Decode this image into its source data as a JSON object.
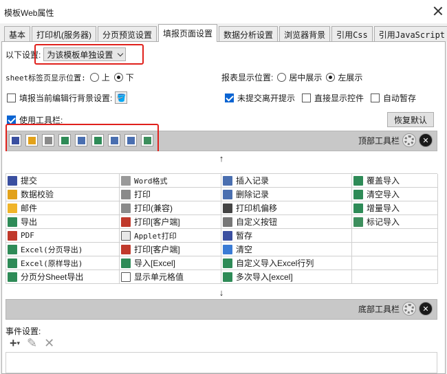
{
  "window": {
    "title": "模板Web属性"
  },
  "tabs": [
    {
      "label": "基本"
    },
    {
      "label": "打印机(服务器)"
    },
    {
      "label": "分页预览设置"
    },
    {
      "label": "填报页面设置"
    },
    {
      "label": "数据分析设置"
    },
    {
      "label": "浏览器背景"
    },
    {
      "label": "引用Css"
    },
    {
      "label": "引用JavaScript"
    }
  ],
  "settings": {
    "scope_label": "以下设置:",
    "scope_value": "为该模板单独设置",
    "sheet_label": "sheet标签页显示位置:",
    "sheet_options": [
      "上",
      "下"
    ],
    "sheet_selected": "下",
    "report_label": "报表显示位置:",
    "report_options": [
      "居中展示",
      "左展示"
    ],
    "report_selected": "左展示",
    "bg_label": "填报当前编辑行背景设置:",
    "unsubmitted_label": "未提交离开提示",
    "direct_label": "直接显示控件",
    "autosave_label": "自动暂存",
    "use_toolbar_label": "使用工具栏:",
    "restore_default": "恢复默认"
  },
  "toolbars": {
    "top_label": "顶部工具栏",
    "bottom_label": "底部工具栏",
    "top_icons": [
      "save-icon",
      "edit-icon",
      "print-icon",
      "export-icon",
      "insert-row-icon",
      "excel-icon",
      "delete-row-icon",
      "insert-row-icon",
      "mark-import-icon"
    ],
    "up_arrow": "↑",
    "down_arrow": "↓"
  },
  "buttons": [
    [
      {
        "label": "提交",
        "icon": "submit-icon",
        "color": "#3a4fa0"
      },
      {
        "label": "Word格式",
        "icon": "word-icon",
        "color": "#9a9a9a",
        "mono": true
      },
      {
        "label": "插入记录",
        "icon": "insert-row-icon",
        "color": "#4a6fb0"
      },
      {
        "label": "覆盖导入",
        "icon": "excel-icon",
        "color": "#2e8b57"
      }
    ],
    [
      {
        "label": "数据校验",
        "icon": "check-icon",
        "color": "#e2a21b"
      },
      {
        "label": "打印",
        "icon": "print-icon",
        "color": "#8a8a8a"
      },
      {
        "label": "删除记录",
        "icon": "delete-row-icon",
        "color": "#4a6fb0"
      },
      {
        "label": "清空导入",
        "icon": "excel-icon",
        "color": "#2e8b57"
      }
    ],
    [
      {
        "label": "邮件",
        "icon": "mail-icon",
        "color": "#f0b429"
      },
      {
        "label": "打印(兼容)",
        "icon": "print-icon",
        "color": "#8a8a8a"
      },
      {
        "label": "打印机偏移",
        "icon": "move-icon",
        "color": "#444444"
      },
      {
        "label": "增量导入",
        "icon": "excel-icon",
        "color": "#2e8b57"
      }
    ],
    [
      {
        "label": "导出",
        "icon": "export-icon",
        "color": "#2e8b57"
      },
      {
        "label": "打印[客户端]",
        "icon": "pdf-print-icon",
        "color": "#c0392b"
      },
      {
        "label": "自定义按钮",
        "icon": "gear-icon",
        "color": "#777777"
      },
      {
        "label": "标记导入",
        "icon": "mark-import-icon",
        "color": "#3d8f5d"
      }
    ],
    [
      {
        "label": "PDF",
        "icon": "pdf-icon",
        "color": "#c0392b",
        "mono": true
      },
      {
        "label": "Applet打印",
        "icon": "applet-icon",
        "color": "#e8e8e8",
        "mono": true
      },
      {
        "label": "暂存",
        "icon": "save-icon",
        "color": "#3a4fa0"
      },
      {
        "label": "",
        "icon": "",
        "color": ""
      }
    ],
    [
      {
        "label": "Excel(分页导出)",
        "icon": "excel-icon",
        "color": "#2e8b57",
        "mono": true
      },
      {
        "label": "打印[客户端]",
        "icon": "pdf-print-icon",
        "color": "#c0392b"
      },
      {
        "label": "清空",
        "icon": "eraser-icon",
        "color": "#3a7bd5"
      },
      {
        "label": "",
        "icon": "",
        "color": ""
      }
    ],
    [
      {
        "label": "Excel(原样导出)",
        "icon": "excel-icon",
        "color": "#2e8b57",
        "mono": true
      },
      {
        "label": "导入[Excel]",
        "icon": "excel-icon",
        "color": "#2e8b57"
      },
      {
        "label": "自定义导入Excel行列",
        "icon": "excel-icon",
        "color": "#2e8b57"
      },
      {
        "label": "",
        "icon": "",
        "color": ""
      }
    ],
    [
      {
        "label": "分页分Sheet导出",
        "icon": "excel-icon",
        "color": "#2e8b57"
      },
      {
        "label": "显示单元格值",
        "icon": "cell-icon",
        "color": "#ffffff"
      },
      {
        "label": "多次导入[excel]",
        "icon": "excel-icon",
        "color": "#2e8b57"
      },
      {
        "label": "",
        "icon": "",
        "color": ""
      }
    ]
  ],
  "events": {
    "label": "事件设置:",
    "add": "+",
    "edit": "✎",
    "delete": "✕"
  }
}
